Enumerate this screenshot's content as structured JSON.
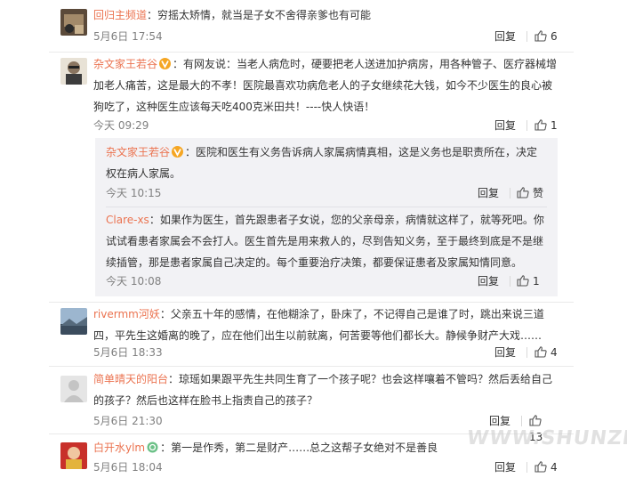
{
  "comments": [
    {
      "user": "回归主频道",
      "text": "穷摇太矫情，就当是子女不舍得亲爹也有可能",
      "date": "5月6日 17:54",
      "reply": "回复",
      "likes": "6"
    },
    {
      "user": "杂文家王若谷",
      "text": "有网友说：当老人病危时，硬要把老人送进加护病房，用各种管子、医疗器械增加老人痛苦，这是最大的不孝！医院最喜欢功病危老人的子女继续花大钱，如今不少医生的良心被狗吃了，这种医生应该每天吃400克米田共！----快人快语！",
      "date": "今天 09:29",
      "reply": "回复",
      "likes": "1"
    },
    {
      "user": "rivermm河妖",
      "text": "父亲五十年的感情，在他糊涂了，卧床了，不记得自己是谁了时，跳出来说三道四，平先生这婚离的晚了，应在他们出生以前就离，何苦要等他们都长大。静候争财产大戏……",
      "date": "5月6日 18:33",
      "reply": "回复",
      "likes": "4"
    },
    {
      "user": "简单晴天的阳台",
      "text": "琼瑶如果跟平先生共同生育了一个孩子呢？也会这样嚷着不管吗？然后丢给自己的孩子？然后也这样在脸书上指责自己的孩子？",
      "date": "5月6日 21:30",
      "reply": "回复",
      "likes": "13"
    },
    {
      "user": "白开水ylm",
      "text": "第一是作秀，第二是财产……总之这帮子女绝对不是善良",
      "date": "5月6日 18:04",
      "reply": "回复",
      "likes": "4"
    }
  ],
  "replies": [
    {
      "user": "杂文家王若谷",
      "text": "医院和医生有义务告诉病人家属病情真相，这是义务也是职责所在，决定权在病人家属。",
      "date": "今天 10:15",
      "reply": "回复",
      "likes": "赞"
    },
    {
      "user": "Clare-xs",
      "text": "如果作为医生，首先跟患者子女说，您的父亲母亲，病情就这样了，就等死吧。你试试看患者家属会不会打人。医生首先是用来救人的，尽到告知义务，至于最终到底是不是继续插管，那是患者家属自己决定的。每个重要治疗决策，都要保证患者及家属知情同意。",
      "date": "今天 10:08",
      "reply": "回复",
      "likes": "1"
    }
  ],
  "separator": "：",
  "watermark": "WWW.SHUNZHI.INFO",
  "colors": {
    "username": "#eb7350",
    "text": "#333333",
    "meta": "#808080",
    "reply_bg": "#f2f2f5"
  },
  "icons": {
    "like": "thumbs-up-icon",
    "verified": "orange-v-badge-icon",
    "wechat": "green-circle-badge-icon"
  }
}
